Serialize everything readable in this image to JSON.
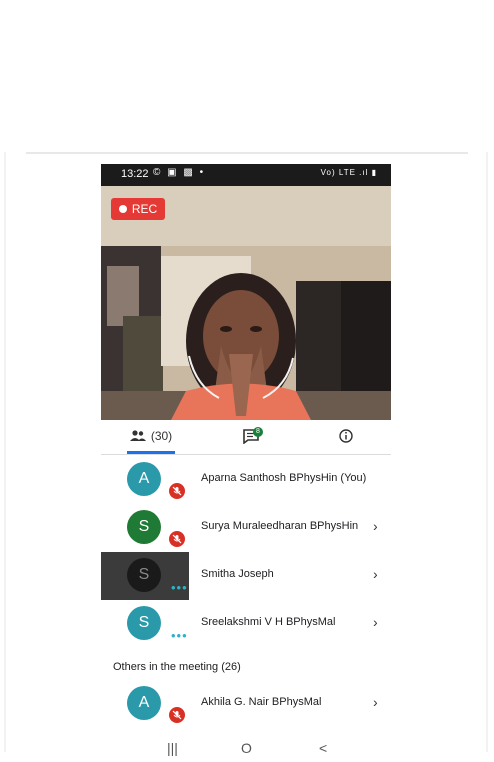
{
  "statusbar": {
    "time": "13:22",
    "left_icons": "© ▣ ▩ •",
    "right_icons": "Vo) LTE .ıl ▮"
  },
  "video": {
    "rec_label": "REC"
  },
  "tabs": {
    "people_count": "(30)",
    "chat_badge": "8"
  },
  "participants": [
    {
      "initial": "A",
      "name": "Aparna Santhosh BPhysHin (You)",
      "color": "#2a9aaa",
      "muted": true,
      "chevron": false,
      "dark_tile": false
    },
    {
      "initial": "S",
      "name": "Surya Muraleedharan BPhysHin",
      "color": "#1e7a34",
      "muted": true,
      "chevron": true,
      "dark_tile": false
    },
    {
      "initial": "S",
      "name": "Smitha Joseph",
      "color": "#1a1a1a",
      "muted": false,
      "chevron": true,
      "dark_tile": true
    },
    {
      "initial": "S",
      "name": "Sreelakshmi V H BPhysMal",
      "color": "#2a9aaa",
      "muted": false,
      "chevron": true,
      "dark_tile": false
    }
  ],
  "others_heading": "Others in the meeting (26)",
  "others": [
    {
      "initial": "A",
      "name": "Akhila G. Nair BPhysMal",
      "color": "#2a9aaa",
      "muted": true,
      "chevron": true
    }
  ],
  "chevron_glyph": "›",
  "navbar": {
    "recent": "|||",
    "home": "O",
    "back": "<"
  }
}
